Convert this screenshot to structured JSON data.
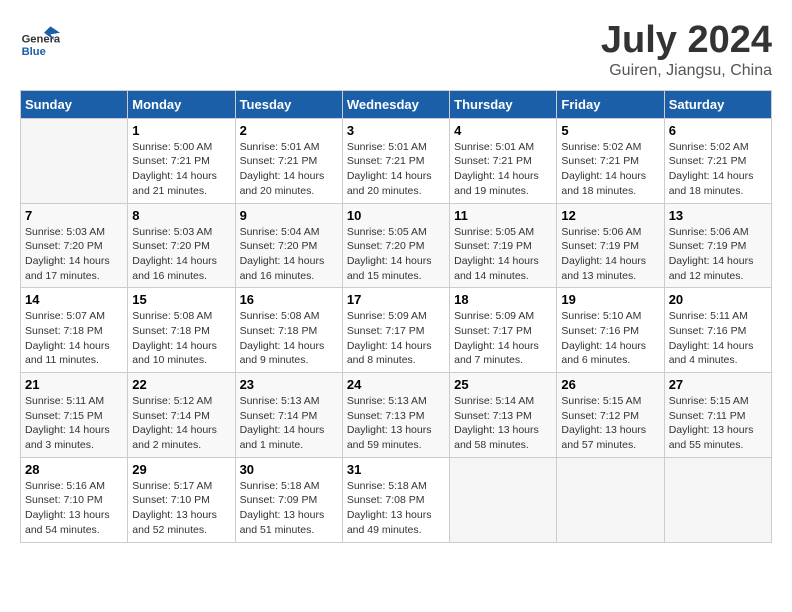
{
  "logo": {
    "line1": "General",
    "line2": "Blue"
  },
  "title": "July 2024",
  "subtitle": "Guiren, Jiangsu, China",
  "headers": [
    "Sunday",
    "Monday",
    "Tuesday",
    "Wednesday",
    "Thursday",
    "Friday",
    "Saturday"
  ],
  "weeks": [
    [
      {
        "day": "",
        "info": ""
      },
      {
        "day": "1",
        "info": "Sunrise: 5:00 AM\nSunset: 7:21 PM\nDaylight: 14 hours\nand 21 minutes."
      },
      {
        "day": "2",
        "info": "Sunrise: 5:01 AM\nSunset: 7:21 PM\nDaylight: 14 hours\nand 20 minutes."
      },
      {
        "day": "3",
        "info": "Sunrise: 5:01 AM\nSunset: 7:21 PM\nDaylight: 14 hours\nand 20 minutes."
      },
      {
        "day": "4",
        "info": "Sunrise: 5:01 AM\nSunset: 7:21 PM\nDaylight: 14 hours\nand 19 minutes."
      },
      {
        "day": "5",
        "info": "Sunrise: 5:02 AM\nSunset: 7:21 PM\nDaylight: 14 hours\nand 18 minutes."
      },
      {
        "day": "6",
        "info": "Sunrise: 5:02 AM\nSunset: 7:21 PM\nDaylight: 14 hours\nand 18 minutes."
      }
    ],
    [
      {
        "day": "7",
        "info": "Sunrise: 5:03 AM\nSunset: 7:20 PM\nDaylight: 14 hours\nand 17 minutes."
      },
      {
        "day": "8",
        "info": "Sunrise: 5:03 AM\nSunset: 7:20 PM\nDaylight: 14 hours\nand 16 minutes."
      },
      {
        "day": "9",
        "info": "Sunrise: 5:04 AM\nSunset: 7:20 PM\nDaylight: 14 hours\nand 16 minutes."
      },
      {
        "day": "10",
        "info": "Sunrise: 5:05 AM\nSunset: 7:20 PM\nDaylight: 14 hours\nand 15 minutes."
      },
      {
        "day": "11",
        "info": "Sunrise: 5:05 AM\nSunset: 7:19 PM\nDaylight: 14 hours\nand 14 minutes."
      },
      {
        "day": "12",
        "info": "Sunrise: 5:06 AM\nSunset: 7:19 PM\nDaylight: 14 hours\nand 13 minutes."
      },
      {
        "day": "13",
        "info": "Sunrise: 5:06 AM\nSunset: 7:19 PM\nDaylight: 14 hours\nand 12 minutes."
      }
    ],
    [
      {
        "day": "14",
        "info": "Sunrise: 5:07 AM\nSunset: 7:18 PM\nDaylight: 14 hours\nand 11 minutes."
      },
      {
        "day": "15",
        "info": "Sunrise: 5:08 AM\nSunset: 7:18 PM\nDaylight: 14 hours\nand 10 minutes."
      },
      {
        "day": "16",
        "info": "Sunrise: 5:08 AM\nSunset: 7:18 PM\nDaylight: 14 hours\nand 9 minutes."
      },
      {
        "day": "17",
        "info": "Sunrise: 5:09 AM\nSunset: 7:17 PM\nDaylight: 14 hours\nand 8 minutes."
      },
      {
        "day": "18",
        "info": "Sunrise: 5:09 AM\nSunset: 7:17 PM\nDaylight: 14 hours\nand 7 minutes."
      },
      {
        "day": "19",
        "info": "Sunrise: 5:10 AM\nSunset: 7:16 PM\nDaylight: 14 hours\nand 6 minutes."
      },
      {
        "day": "20",
        "info": "Sunrise: 5:11 AM\nSunset: 7:16 PM\nDaylight: 14 hours\nand 4 minutes."
      }
    ],
    [
      {
        "day": "21",
        "info": "Sunrise: 5:11 AM\nSunset: 7:15 PM\nDaylight: 14 hours\nand 3 minutes."
      },
      {
        "day": "22",
        "info": "Sunrise: 5:12 AM\nSunset: 7:14 PM\nDaylight: 14 hours\nand 2 minutes."
      },
      {
        "day": "23",
        "info": "Sunrise: 5:13 AM\nSunset: 7:14 PM\nDaylight: 14 hours\nand 1 minute."
      },
      {
        "day": "24",
        "info": "Sunrise: 5:13 AM\nSunset: 7:13 PM\nDaylight: 13 hours\nand 59 minutes."
      },
      {
        "day": "25",
        "info": "Sunrise: 5:14 AM\nSunset: 7:13 PM\nDaylight: 13 hours\nand 58 minutes."
      },
      {
        "day": "26",
        "info": "Sunrise: 5:15 AM\nSunset: 7:12 PM\nDaylight: 13 hours\nand 57 minutes."
      },
      {
        "day": "27",
        "info": "Sunrise: 5:15 AM\nSunset: 7:11 PM\nDaylight: 13 hours\nand 55 minutes."
      }
    ],
    [
      {
        "day": "28",
        "info": "Sunrise: 5:16 AM\nSunset: 7:10 PM\nDaylight: 13 hours\nand 54 minutes."
      },
      {
        "day": "29",
        "info": "Sunrise: 5:17 AM\nSunset: 7:10 PM\nDaylight: 13 hours\nand 52 minutes."
      },
      {
        "day": "30",
        "info": "Sunrise: 5:18 AM\nSunset: 7:09 PM\nDaylight: 13 hours\nand 51 minutes."
      },
      {
        "day": "31",
        "info": "Sunrise: 5:18 AM\nSunset: 7:08 PM\nDaylight: 13 hours\nand 49 minutes."
      },
      {
        "day": "",
        "info": ""
      },
      {
        "day": "",
        "info": ""
      },
      {
        "day": "",
        "info": ""
      }
    ]
  ]
}
